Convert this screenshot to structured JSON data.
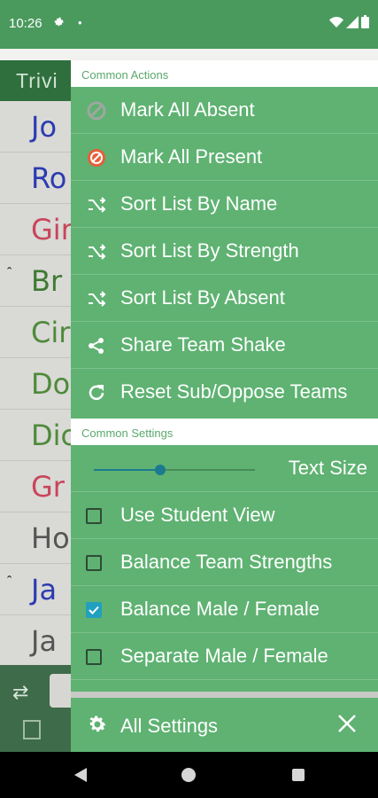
{
  "status_bar": {
    "time": "10:26",
    "dot": "•"
  },
  "background": {
    "toolbar_title": "Trivi",
    "rows": [
      {
        "text": "Jo",
        "color": "#2c3bb0",
        "caret": ""
      },
      {
        "text": "Ro",
        "color": "#2c3bb0",
        "caret": ""
      },
      {
        "text": "Gir",
        "color": "#c9455a",
        "caret": ""
      },
      {
        "text": "Br",
        "color": "#3f7a32",
        "caret": "ˆ"
      },
      {
        "text": "Cir",
        "color": "#4e8a3a",
        "caret": ""
      },
      {
        "text": "Do",
        "color": "#4e8a3a",
        "caret": ""
      },
      {
        "text": "Dic",
        "color": "#4e8a3a",
        "caret": ""
      },
      {
        "text": "Gr",
        "color": "#c9455a",
        "caret": ""
      },
      {
        "text": "Ho",
        "color": "#555555",
        "caret": ""
      },
      {
        "text": "Ja",
        "color": "#2c3bb0",
        "caret": "ˆ"
      },
      {
        "text": "Ja",
        "color": "#555555",
        "caret": ""
      }
    ]
  },
  "drawer": {
    "common_actions_header": "Common Actions",
    "actions": [
      {
        "label": "Mark All Absent",
        "icon": "absent-icon"
      },
      {
        "label": "Mark All Present",
        "icon": "present-icon"
      },
      {
        "label": "Sort List By Name",
        "icon": "shuffle-icon"
      },
      {
        "label": "Sort List By Strength",
        "icon": "shuffle-icon"
      },
      {
        "label": "Sort List By Absent",
        "icon": "shuffle-icon"
      },
      {
        "label": "Share Team Shake",
        "icon": "share-icon"
      },
      {
        "label": "Reset Sub/Oppose Teams",
        "icon": "refresh-icon"
      }
    ],
    "common_settings_header": "Common Settings",
    "text_size_label": "Text Size",
    "text_size_level": 0.41,
    "settings": [
      {
        "label": "Use Student View",
        "checked": false
      },
      {
        "label": "Balance Team Strengths",
        "checked": false
      },
      {
        "label": "Balance Male / Female",
        "checked": true
      },
      {
        "label": "Separate Male / Female",
        "checked": false
      }
    ],
    "all_settings_label": "All Settings"
  },
  "colors": {
    "drawer_bg": "#5fb272",
    "accent": "#21a0bf",
    "status_bar": "#4a9a5e"
  }
}
